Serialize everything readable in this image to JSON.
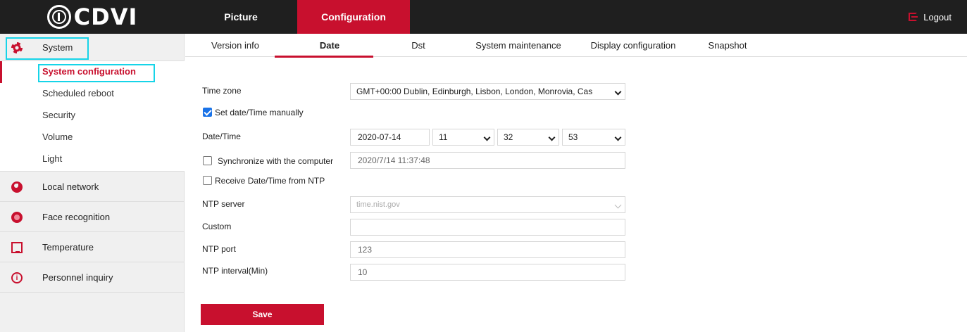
{
  "header": {
    "logo_text": "CDVI",
    "tabs": [
      {
        "label": "Picture"
      },
      {
        "label": "Configuration"
      }
    ],
    "logout_label": "Logout"
  },
  "sidebar": {
    "groups": [
      {
        "label": "System",
        "icon": "gear-icon"
      },
      {
        "label": "Local network",
        "icon": "globe-icon"
      },
      {
        "label": "Face recognition",
        "icon": "face-icon"
      },
      {
        "label": "Temperature",
        "icon": "monitor-icon"
      },
      {
        "label": "Personnel inquiry",
        "icon": "info-icon"
      }
    ],
    "system_items": [
      {
        "label": "System configuration"
      },
      {
        "label": "Scheduled reboot"
      },
      {
        "label": "Security"
      },
      {
        "label": "Volume"
      },
      {
        "label": "Light"
      }
    ]
  },
  "subtabs": [
    {
      "label": "Version info"
    },
    {
      "label": "Date"
    },
    {
      "label": "Dst"
    },
    {
      "label": "System maintenance"
    },
    {
      "label": "Display configuration"
    },
    {
      "label": "Snapshot"
    }
  ],
  "form": {
    "timezone_label": "Time zone",
    "timezone_value": "GMT+00:00 Dublin, Edinburgh, Lisbon, London, Monrovia, Cas",
    "set_manually_label": "Set date/Time manually",
    "set_manually_checked": true,
    "datetime_label": "Date/Time",
    "date_value": "2020-07-14",
    "hour_value": "11",
    "minute_value": "32",
    "second_value": "53",
    "sync_label": "Synchronize with the computer",
    "sync_checked": false,
    "sync_value": "2020/7/14 11:37:48",
    "ntp_receive_label": "Receive Date/Time from NTP",
    "ntp_receive_checked": false,
    "ntp_server_label": "NTP server",
    "ntp_server_value": "time.nist.gov",
    "custom_label": "Custom",
    "custom_value": "",
    "ntp_port_label": "NTP port",
    "ntp_port_value": "123",
    "ntp_interval_label": "NTP interval(Min)",
    "ntp_interval_value": "10",
    "save_label": "Save"
  },
  "colors": {
    "accent": "#c8102e",
    "highlight": "#16d4e8",
    "topbar": "#1f1f1f"
  }
}
